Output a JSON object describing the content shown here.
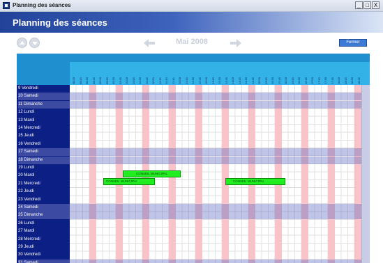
{
  "window": {
    "title": "Planning des séances",
    "controls": [
      "_",
      "□",
      "X"
    ]
  },
  "header": {
    "title": "Planning des séances"
  },
  "toolbar": {
    "month": "Mai 2008",
    "close_label": "Fermer"
  },
  "hours": [
    "08:00",
    "08:15",
    "08:30",
    "08:45",
    "09:00",
    "09:15",
    "09:30",
    "09:45",
    "10:00",
    "10:15",
    "10:30",
    "10:45",
    "11:00",
    "11:15",
    "11:30",
    "11:45",
    "12:00",
    "12:15",
    "12:30",
    "12:45",
    "13:00",
    "13:15",
    "13:30",
    "13:45",
    "14:00",
    "14:15",
    "14:30",
    "14:45",
    "15:00",
    "15:15",
    "15:30",
    "15:45",
    "16:00",
    "16:15",
    "16:30",
    "16:45",
    "17:00",
    "17:15",
    "17:30",
    "17:45",
    "18:00",
    "18:15",
    "18:30",
    "18:45"
  ],
  "days": [
    {
      "label": "9 Vendredi",
      "weekend": false
    },
    {
      "label": "10 Samedi",
      "weekend": true
    },
    {
      "label": "11 Dimanche",
      "weekend": true
    },
    {
      "label": "12 Lundi",
      "weekend": false
    },
    {
      "label": "13 Mardi",
      "weekend": false
    },
    {
      "label": "14 Mercredi",
      "weekend": false
    },
    {
      "label": "15 Jeudi",
      "weekend": false
    },
    {
      "label": "16 Vendredi",
      "weekend": false
    },
    {
      "label": "17 Samedi",
      "weekend": true
    },
    {
      "label": "18 Dimanche",
      "weekend": true
    },
    {
      "label": "19 Lundi",
      "weekend": false
    },
    {
      "label": "20 Mardi",
      "weekend": false
    },
    {
      "label": "21 Mercredi",
      "weekend": false
    },
    {
      "label": "22 Jeudi",
      "weekend": false
    },
    {
      "label": "23 Vendredi",
      "weekend": false
    },
    {
      "label": "24 Samedi",
      "weekend": true
    },
    {
      "label": "25 Dimanche",
      "weekend": true
    },
    {
      "label": "26 Lundi",
      "weekend": false
    },
    {
      "label": "27 Mardi",
      "weekend": false
    },
    {
      "label": "28 Mercredi",
      "weekend": false
    },
    {
      "label": "29 Jeudi",
      "weekend": false
    },
    {
      "label": "30 Vendredi",
      "weekend": false
    },
    {
      "label": "31 Samedi",
      "weekend": true
    }
  ],
  "events": [
    {
      "label": "CONSEIL MUNICIPAL",
      "day": "20 Mardi"
    },
    {
      "label": "CONSEIL MUNICIPAL",
      "day": "21 Mercredi"
    },
    {
      "label": "CONSEIL MUNICIPAL",
      "day": "21 Mercredi"
    }
  ]
}
